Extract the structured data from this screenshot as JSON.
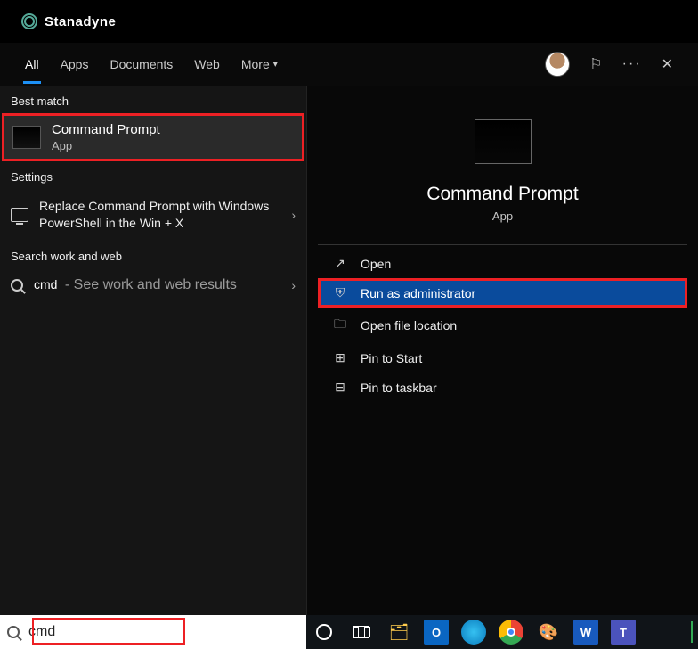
{
  "brand": {
    "name": "Stanadyne"
  },
  "tabs": {
    "items": [
      {
        "label": "All",
        "active": true
      },
      {
        "label": "Apps"
      },
      {
        "label": "Documents"
      },
      {
        "label": "Web"
      },
      {
        "label": "More"
      }
    ]
  },
  "left": {
    "best_match_label": "Best match",
    "best": {
      "title": "Command Prompt",
      "subtitle": "App"
    },
    "settings_label": "Settings",
    "settings_item": "Replace Command Prompt with Windows PowerShell in the Win + X",
    "web_label": "Search work and web",
    "web_query": "cmd",
    "web_hint": "- See work and web results"
  },
  "detail": {
    "title": "Command Prompt",
    "subtitle": "App",
    "actions": [
      {
        "icon": "↗",
        "label": "Open"
      },
      {
        "icon": "⛨",
        "label": "Run as administrator",
        "selected": true,
        "highlight": true
      },
      {
        "icon": "🗀",
        "label": "Open file location"
      },
      {
        "icon": "⊞",
        "label": "Pin to Start"
      },
      {
        "icon": "⊟",
        "label": "Pin to taskbar"
      }
    ]
  },
  "search": {
    "value": "cmd"
  }
}
